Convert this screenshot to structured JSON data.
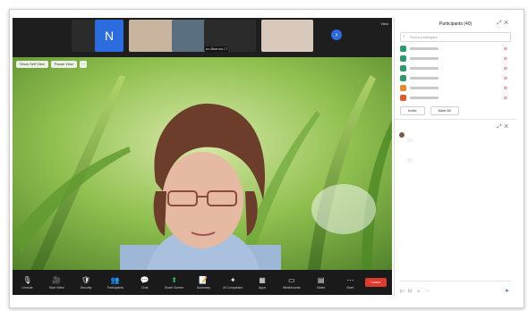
{
  "top_strip": {
    "thumbs": [
      {
        "caption": "",
        "bg": "#2b2b2b"
      },
      {
        "caption": "N",
        "bg": "#2d6cdf"
      },
      {
        "caption": "",
        "bg": "#c9b4a0"
      },
      {
        "caption": "",
        "bg": "#5a6f80"
      },
      {
        "caption": "ดร.เติมธวจน LT",
        "bg": "#2b2b2b"
      },
      {
        "caption": "",
        "bg": "#d9c9bc"
      }
    ],
    "view_label": "View"
  },
  "video": {
    "top_buttons": [
      "Show Self View",
      "Pause View"
    ]
  },
  "toolbar": {
    "items": [
      {
        "icon": "mic-icon",
        "glyph": "🎙",
        "label": "Unmute"
      },
      {
        "icon": "video-icon",
        "glyph": "🎥",
        "label": "Start Video"
      },
      {
        "icon": "security-icon",
        "glyph": "🛡",
        "label": "Security"
      },
      {
        "icon": "participants-icon",
        "glyph": "👥",
        "label": "Participants"
      },
      {
        "icon": "chat-icon",
        "glyph": "💬",
        "label": "Chat"
      },
      {
        "icon": "share-icon",
        "glyph": "⬆",
        "label": "Share Screen"
      },
      {
        "icon": "summary-icon",
        "glyph": "📝",
        "label": "Summary"
      },
      {
        "icon": "companion-icon",
        "glyph": "✦",
        "label": "AI Companion"
      },
      {
        "icon": "apps-icon",
        "glyph": "▦",
        "label": "Apps"
      },
      {
        "icon": "whiteboard-icon",
        "glyph": "▭",
        "label": "Whiteboards"
      },
      {
        "icon": "notes-icon",
        "glyph": "▤",
        "label": "Notes"
      },
      {
        "icon": "more-icon",
        "glyph": "⋯",
        "label": "More"
      }
    ],
    "leave_label": "Leave"
  },
  "panel": {
    "participants_title": "Participants (40)",
    "search_placeholder": "Find a participant",
    "participants": [
      {
        "avatar_color": "#2e9b6c"
      },
      {
        "avatar_color": "#2e9b6c"
      },
      {
        "avatar_color": "#2e9b6c"
      },
      {
        "avatar_color": "#2e9b6c"
      },
      {
        "avatar_color": "#e88a2a"
      },
      {
        "avatar_color": "#e05b2a"
      }
    ],
    "invite_label": "Invite",
    "mute_label": "Mute All",
    "chat_title": "",
    "messages": [
      {
        "text": ""
      },
      {
        "text": ""
      }
    ],
    "input_placeholder": ""
  }
}
